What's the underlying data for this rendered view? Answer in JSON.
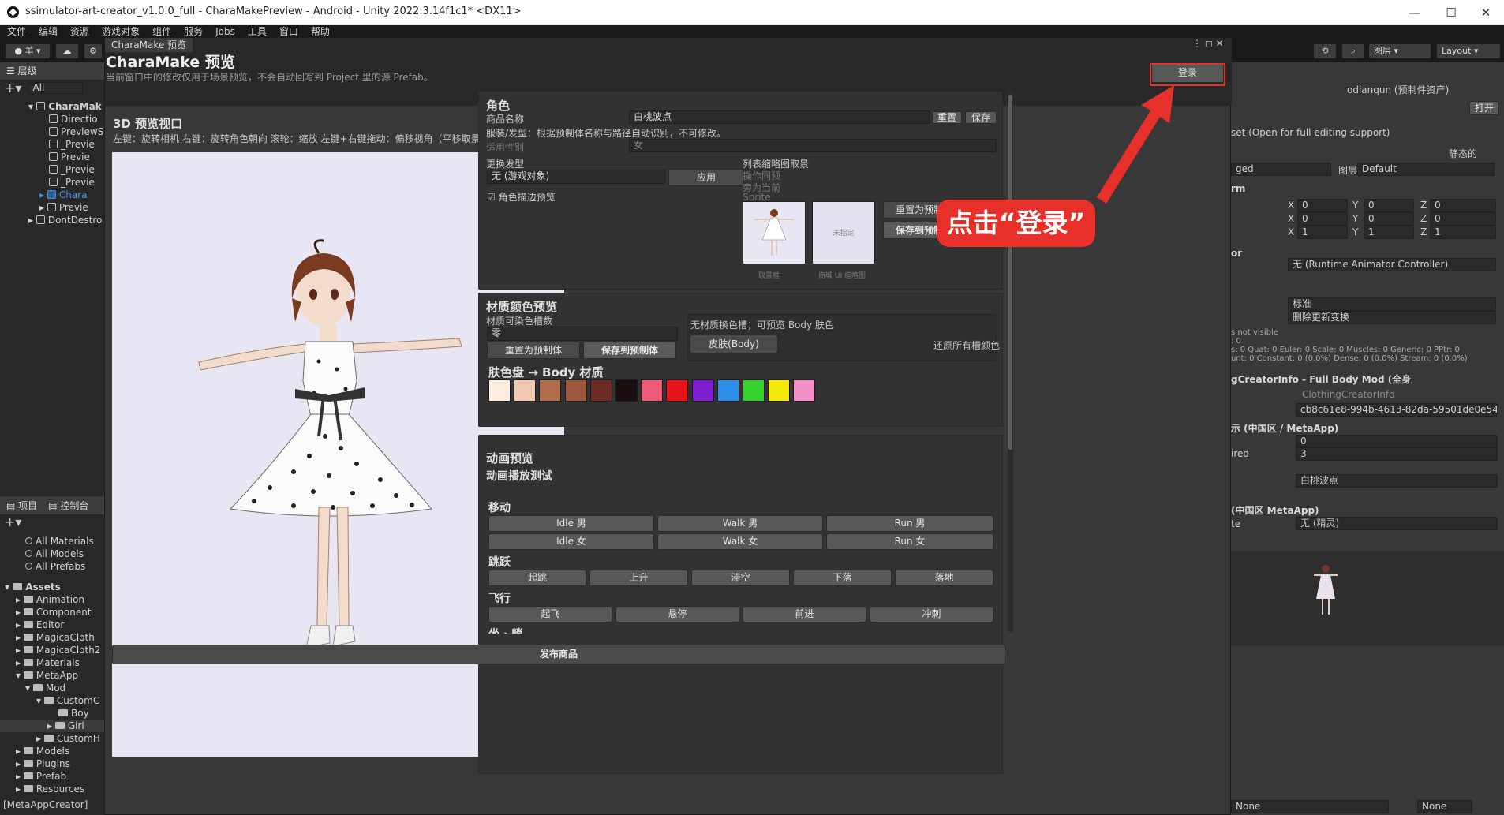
{
  "title_bar": {
    "title": "ssimulator-art-creator_v1.0.0_full - CharaMakePreview - Android - Unity 2022.3.14f1c1* <DX11>",
    "minimize": "—",
    "maximize": "☐",
    "close": "✕"
  },
  "menu": [
    "文件",
    "编辑",
    "资源",
    "游戏对象",
    "组件",
    "服务",
    "Jobs",
    "工具",
    "窗口",
    "帮助"
  ],
  "toolbar": {
    "account": "羊",
    "layers": "图层",
    "layout": "Layout"
  },
  "hierarchy": {
    "tab": "层级",
    "search_placeholder": "All",
    "items": [
      "CharaMak",
      "Directio",
      "PreviewS",
      "_Previe",
      "Previe",
      "_Previe",
      "_Previe",
      "Chara",
      "Previe",
      "DontDestro"
    ]
  },
  "project": {
    "tab_project": "项目",
    "tab_console": "控制台",
    "favorites": [
      "All Materials",
      "All Models",
      "All Prefabs"
    ],
    "assets_root": "Assets",
    "folders": [
      "Animation",
      "Component",
      "Editor",
      "MagicaCloth",
      "MagicaCloth2",
      "Materials",
      "MetaApp",
      "Mod",
      "CustomC",
      "Boy",
      "Girl",
      "CustomH",
      "Models",
      "Plugins",
      "Prefab",
      "Resources"
    ],
    "status": "[MetaAppCreator]"
  },
  "window": {
    "tab": "CharaMake 预览",
    "title": "CharaMake 预览",
    "subtitle": "当前窗口中的修改仅用于场景预览，不会自动回写到 Project 里的源 Prefab。",
    "login_button": "登录",
    "viewport": {
      "title": "3D 预览视口",
      "hint": "左键：旋转相机    右键：旋转角色朝向    滚轮：缩放    左键+右键拖动：偏移视角（平移取景）"
    },
    "role": {
      "section": "角色",
      "product_name_label": "商品名称",
      "product_name_value": "白桃波点",
      "reset": "重置",
      "save": "保存",
      "clothing_note": "服装/发型：根据预制体名称与路径自动识别，不可修改。",
      "gender_label": "适用性别",
      "gender_value": "女",
      "hair_label": "更换发型",
      "hair_value": "无 (游戏对象)",
      "apply": "应用",
      "outline_preview": "角色描边预览",
      "thumb_section": "列表缩略图取景",
      "thumb_note1": "操作同预",
      "thumb_note2": "旁为当前",
      "thumb_note3": "Sprite",
      "reset_prefab": "重置为预制体",
      "save_prefab": "保存到预制体",
      "thumb_caption_1": "取景框",
      "thumb_unassigned": "未指定",
      "thumb_caption_2": "商城 UI 缩略图"
    },
    "material": {
      "section": "材质颜色预览",
      "slots_label": "材质可染色槽数",
      "slots_value": "零",
      "reset_prefab": "重置为预制体",
      "save_prefab": "保存到预制体",
      "no_slot_note": "无材质换色槽；可预览 Body 肤色",
      "skin_button": "皮肤(Body)",
      "restore_all": "还原所有槽颜色",
      "palette_title": "肤色盘 → Body 材质",
      "swatches": [
        "#fbeee0",
        "#f2c9b0",
        "#b06e4e",
        "#9a573c",
        "#6e2b24",
        "#1a0e0e",
        "#f05a78",
        "#e8141c",
        "#7d1fd0",
        "#2e8fea",
        "#35d12d",
        "#f4ea0a",
        "#f48fc8"
      ]
    },
    "animation": {
      "section": "动画预览",
      "test": "动画播放测试",
      "move": "移动",
      "move_buttons": [
        "Idle 男",
        "Walk 男",
        "Run 男",
        "Idle 女",
        "Walk 女",
        "Run 女"
      ],
      "jump": "跳跃",
      "jump_buttons": [
        "起跳",
        "上升",
        "滞空",
        "下落",
        "落地"
      ],
      "fly": "飞行",
      "fly_buttons": [
        "起飞",
        "悬停",
        "前进",
        "冲刺"
      ],
      "sit": "坐 · 躺"
    },
    "publish": "发布商品"
  },
  "inspector": {
    "owner": "odianqun (预制件资产)",
    "open": "打开",
    "open_note": "set (Open for full editing support)",
    "static": "静态的",
    "tag": "ged",
    "layer_label": "图层",
    "layer_value": "Default",
    "transform": "rm",
    "pos": [
      "0",
      "0",
      "0"
    ],
    "rot": [
      "0",
      "0",
      "0"
    ],
    "scale": [
      "1",
      "1",
      "1"
    ],
    "animator": "or",
    "controller": "无 (Runtime Animator Controller)",
    "culling": "标准",
    "update": "删除更新变换",
    "info1": "s not visible",
    "info2": ": 0",
    "info3": "s: 0 Quat: 0 Euler: 0 Scale: 0 Muscles: 0 Generic: 0 PPtr: 0",
    "info4": "unt: 0 Constant: 0 (0.0%) Dense: 0 (0.0%) Stream: 0 (0.0%)",
    "component": "gCreatorInfo - Full Body Mod (全身服装)",
    "script": "ClothingCreatorInfo",
    "guid": "cb8c61e8-994b-4613-82da-59501de0e54",
    "cn_section": "示 (中国区 / MetaApp)",
    "val0": "0",
    "required_label": "ired",
    "val3": "3",
    "name_value": "白桃波点",
    "cn_section2": "(中国区 MetaApp)",
    "sprite_label": "te",
    "sprite_value": "无 (精灵)",
    "bottom_left": "None",
    "bottom_right": "None"
  },
  "annotation": {
    "callout": "点击“登录”"
  }
}
